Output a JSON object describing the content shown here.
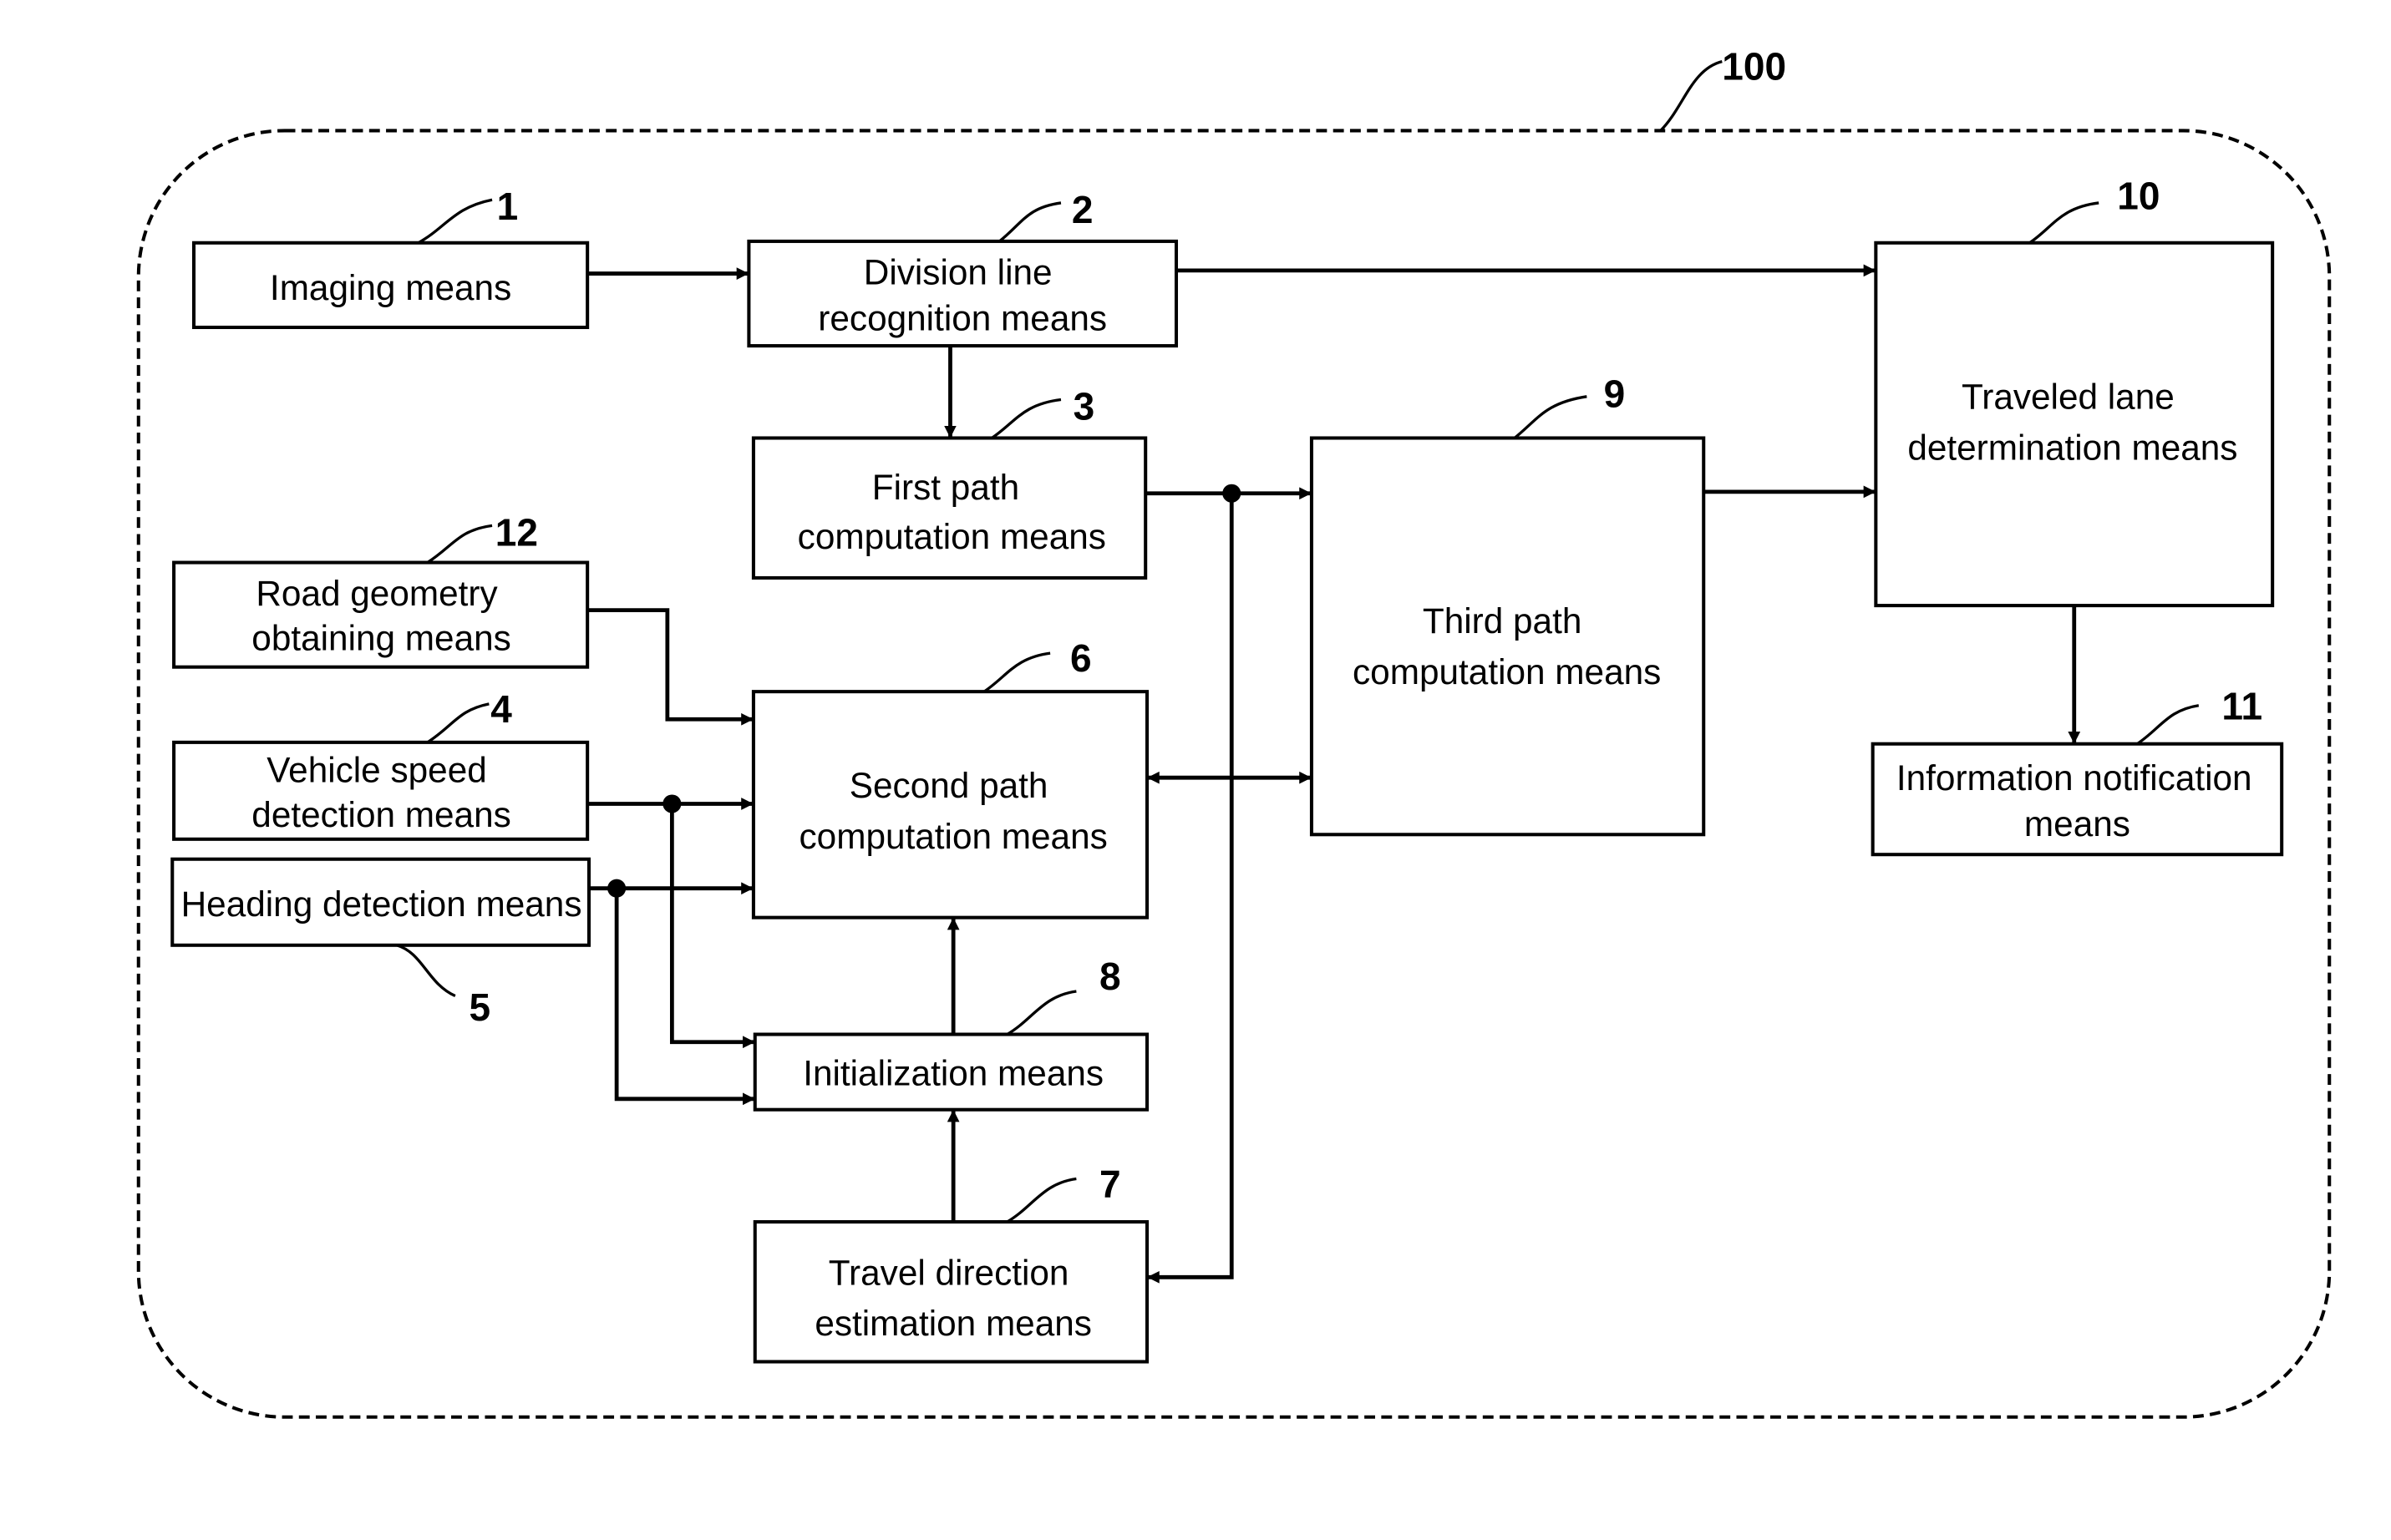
{
  "diagram": {
    "system_ref": "100",
    "blocks": {
      "imaging": {
        "ref": "1",
        "lines": [
          "Imaging means"
        ]
      },
      "division": {
        "ref": "2",
        "lines": [
          "Division line",
          "recognition means"
        ]
      },
      "first_path": {
        "ref": "3",
        "lines": [
          "First path",
          "computation means"
        ]
      },
      "vehicle_speed": {
        "ref": "4",
        "lines": [
          "Vehicle speed",
          "detection means"
        ]
      },
      "heading": {
        "ref": "5",
        "lines": [
          "Heading detection means"
        ]
      },
      "second_path": {
        "ref": "6",
        "lines": [
          "Second path",
          "computation means"
        ]
      },
      "travel_direction": {
        "ref": "7",
        "lines": [
          "Travel direction",
          "estimation means"
        ]
      },
      "initialization": {
        "ref": "8",
        "lines": [
          "Initialization means"
        ]
      },
      "third_path": {
        "ref": "9",
        "lines": [
          "Third path",
          "computation means"
        ]
      },
      "traveled_lane": {
        "ref": "10",
        "lines": [
          "Traveled lane",
          "determination means"
        ]
      },
      "info_notification": {
        "ref": "11",
        "lines": [
          "Information notification",
          "means"
        ]
      },
      "road_geometry": {
        "ref": "12",
        "lines": [
          "Road geometry",
          "obtaining means"
        ]
      }
    },
    "connections": [
      {
        "from": "imaging",
        "to": "division"
      },
      {
        "from": "division",
        "to": "first_path"
      },
      {
        "from": "division",
        "to": "traveled_lane"
      },
      {
        "from": "first_path",
        "to": "third_path"
      },
      {
        "from": "first_path",
        "to": "travel_direction"
      },
      {
        "from": "third_path",
        "to": "traveled_lane"
      },
      {
        "from": "traveled_lane",
        "to": "info_notification"
      },
      {
        "from": "road_geometry",
        "to": "second_path"
      },
      {
        "from": "vehicle_speed",
        "to": "second_path"
      },
      {
        "from": "vehicle_speed",
        "to": "initialization"
      },
      {
        "from": "heading",
        "to": "second_path"
      },
      {
        "from": "heading",
        "to": "initialization"
      },
      {
        "from": "second_path",
        "to": "third_path",
        "bidirectional": true
      },
      {
        "from": "initialization",
        "to": "second_path"
      },
      {
        "from": "travel_direction",
        "to": "initialization"
      }
    ]
  }
}
